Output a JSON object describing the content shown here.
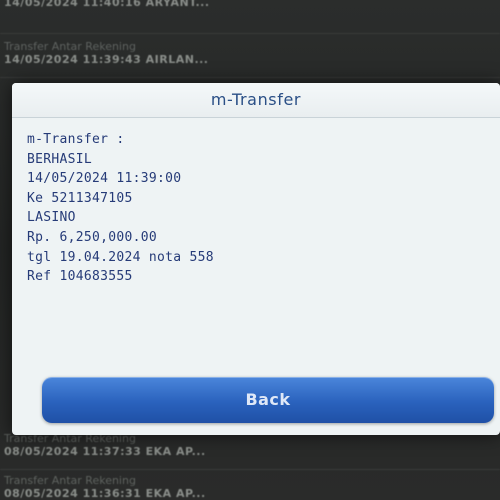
{
  "background_list": [
    {
      "line1": "",
      "line2": "14/05/2024 11:40:16 ARYANT..."
    },
    {
      "line1": "Transfer Antar Rekening",
      "line2": "14/05/2024 11:39:43 AIRLAN..."
    },
    {
      "line1": "Transfer Antar Rekening",
      "line2": "08/05/2024 11:37:33 EKA AP..."
    },
    {
      "line1": "Transfer Antar Rekening",
      "line2": "08/05/2024 11:36:31 EKA AP..."
    }
  ],
  "dialog": {
    "title": "m-Transfer",
    "lines": [
      "m-Transfer :",
      "BERHASIL",
      "14/05/2024 11:39:00",
      "Ke 5211347105",
      "LASINO",
      "Rp. 6,250,000.00",
      "tgl 19.04.2024 nota 558",
      "Ref 104683555"
    ],
    "back_label": "Back"
  },
  "colors": {
    "dialog_bg": "#eef3f4",
    "text": "#263b78",
    "title": "#2a4f86",
    "button": "#2a62bd"
  }
}
